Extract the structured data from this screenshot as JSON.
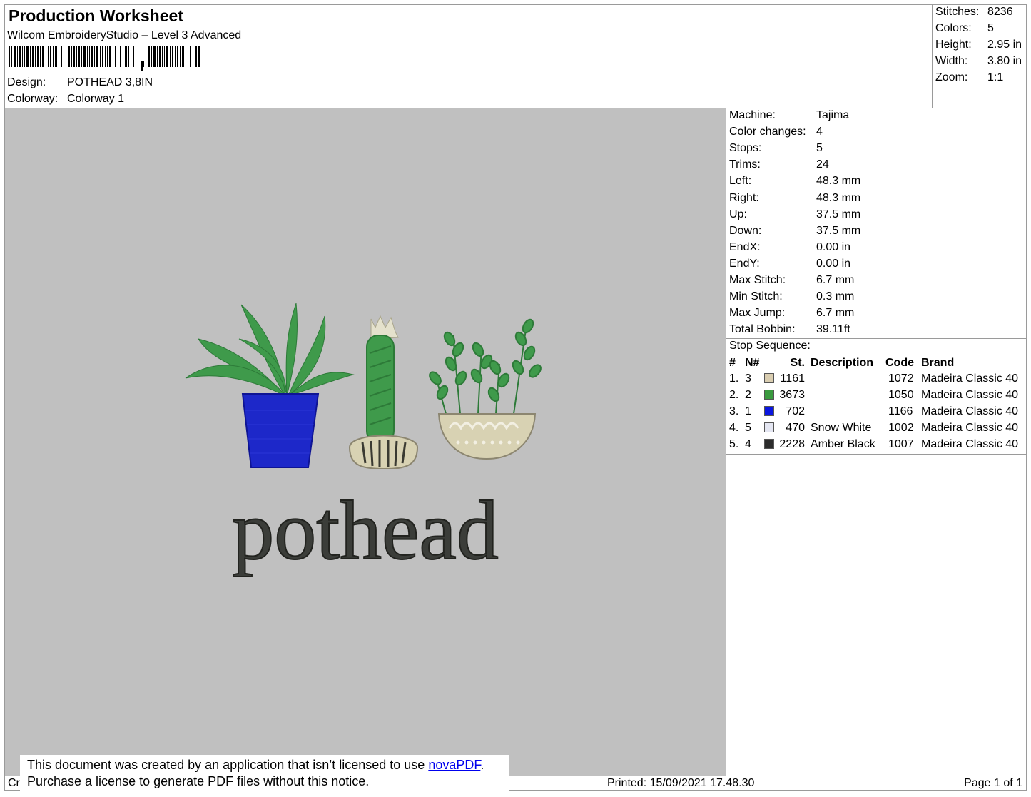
{
  "header": {
    "title": "Production Worksheet",
    "subtitle": "Wilcom EmbroideryStudio – Level 3 Advanced",
    "design_label": "Design:",
    "design_value": "POTHEAD 3,8IN",
    "colorway_label": "Colorway:",
    "colorway_value": "Colorway 1"
  },
  "summary": [
    {
      "label": "Stitches:",
      "value": "8236"
    },
    {
      "label": "Colors:",
      "value": "5"
    },
    {
      "label": "Height:",
      "value": "2.95 in"
    },
    {
      "label": "Width:",
      "value": "3.80 in"
    },
    {
      "label": "Zoom:",
      "value": "1:1"
    }
  ],
  "machine_info": [
    {
      "label": "Machine:",
      "value": "Tajima"
    },
    {
      "label": "Color changes:",
      "value": "4"
    },
    {
      "label": "Stops:",
      "value": "5"
    },
    {
      "label": "Trims:",
      "value": "24"
    },
    {
      "label": "Left:",
      "value": "48.3 mm"
    },
    {
      "label": "Right:",
      "value": "48.3 mm"
    },
    {
      "label": "Up:",
      "value": "37.5 mm"
    },
    {
      "label": "Down:",
      "value": "37.5 mm"
    },
    {
      "label": "EndX:",
      "value": "0.00 in"
    },
    {
      "label": "EndY:",
      "value": "0.00 in"
    },
    {
      "label": "Max Stitch:",
      "value": "6.7 mm"
    },
    {
      "label": "Min Stitch:",
      "value": "0.3 mm"
    },
    {
      "label": "Max Jump:",
      "value": "6.7 mm"
    },
    {
      "label": "Total Bobbin:",
      "value": "39.11ft"
    }
  ],
  "stop_sequence": {
    "title": "Stop Sequence:",
    "headers": {
      "num": "#",
      "needle": "N#",
      "stitches": "St.",
      "description": "Description",
      "code": "Code",
      "brand": "Brand"
    },
    "rows": [
      {
        "num": "1.",
        "needle": "3",
        "color": "#d9cdb0",
        "stitches": "1161",
        "description": "",
        "code": "1072",
        "brand": "Madeira Classic 40"
      },
      {
        "num": "2.",
        "needle": "2",
        "color": "#3a9a3f",
        "stitches": "3673",
        "description": "",
        "code": "1050",
        "brand": "Madeira Classic 40"
      },
      {
        "num": "3.",
        "needle": "1",
        "color": "#0a16e0",
        "stitches": "702",
        "description": "",
        "code": "1166",
        "brand": "Madeira Classic 40"
      },
      {
        "num": "4.",
        "needle": "5",
        "color": "#e4e6f2",
        "stitches": "470",
        "description": "Snow White",
        "code": "1002",
        "brand": "Madeira Classic 40"
      },
      {
        "num": "5.",
        "needle": "4",
        "color": "#2c2c2c",
        "stitches": "2228",
        "description": "Amber Black",
        "code": "1007",
        "brand": "Madeira Classic 40"
      }
    ]
  },
  "design_preview": {
    "text": "pothead",
    "text_color": "#3b3d39",
    "pot_color": "#1d28c9",
    "leaf_color": "#3f9a4b",
    "cream_color": "#d8d2b3"
  },
  "footer": {
    "left_text": "Cr",
    "printed": "Printed: 15/09/2021 17.48.30",
    "page": "Page 1 of 1"
  },
  "notice": {
    "line1_pre": "This document was created by an application that isn’t licensed to use ",
    "link": "novaPDF",
    "line1_post": ".",
    "line2": "Purchase a license to generate PDF files without this notice."
  }
}
